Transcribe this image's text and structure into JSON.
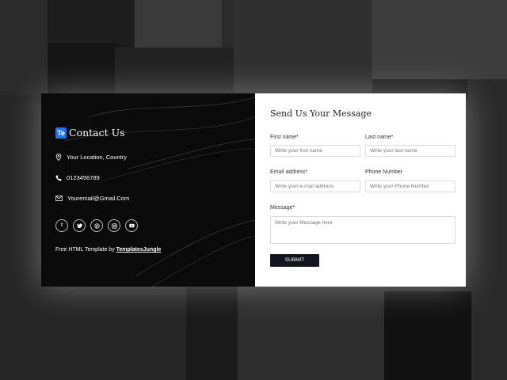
{
  "contact": {
    "title": "Contact Us",
    "logo_text": "Te",
    "location": "Your Location, Country",
    "phone": "0123456789",
    "email": "Youremail@Gmail.Com",
    "socials": [
      "facebook-icon",
      "twitter-icon",
      "pinterest-icon",
      "instagram-icon",
      "youtube-icon"
    ],
    "credit_prefix": "Free HTML Template by ",
    "credit_link": "TemplatesJungle"
  },
  "form": {
    "title": "Send Us Your Message",
    "first_name_label": "First name*",
    "first_name_placeholder": "Write your first name",
    "last_name_label": "Last name*",
    "last_name_placeholder": "Write your last name",
    "email_label": "Email address*",
    "email_placeholder": "Write your e-mail address",
    "phone_label": "Phone Number",
    "phone_placeholder": "Write your Phone Number",
    "message_label": "Message*",
    "message_placeholder": "Write your Message here",
    "submit_label": "SUBMIT"
  }
}
